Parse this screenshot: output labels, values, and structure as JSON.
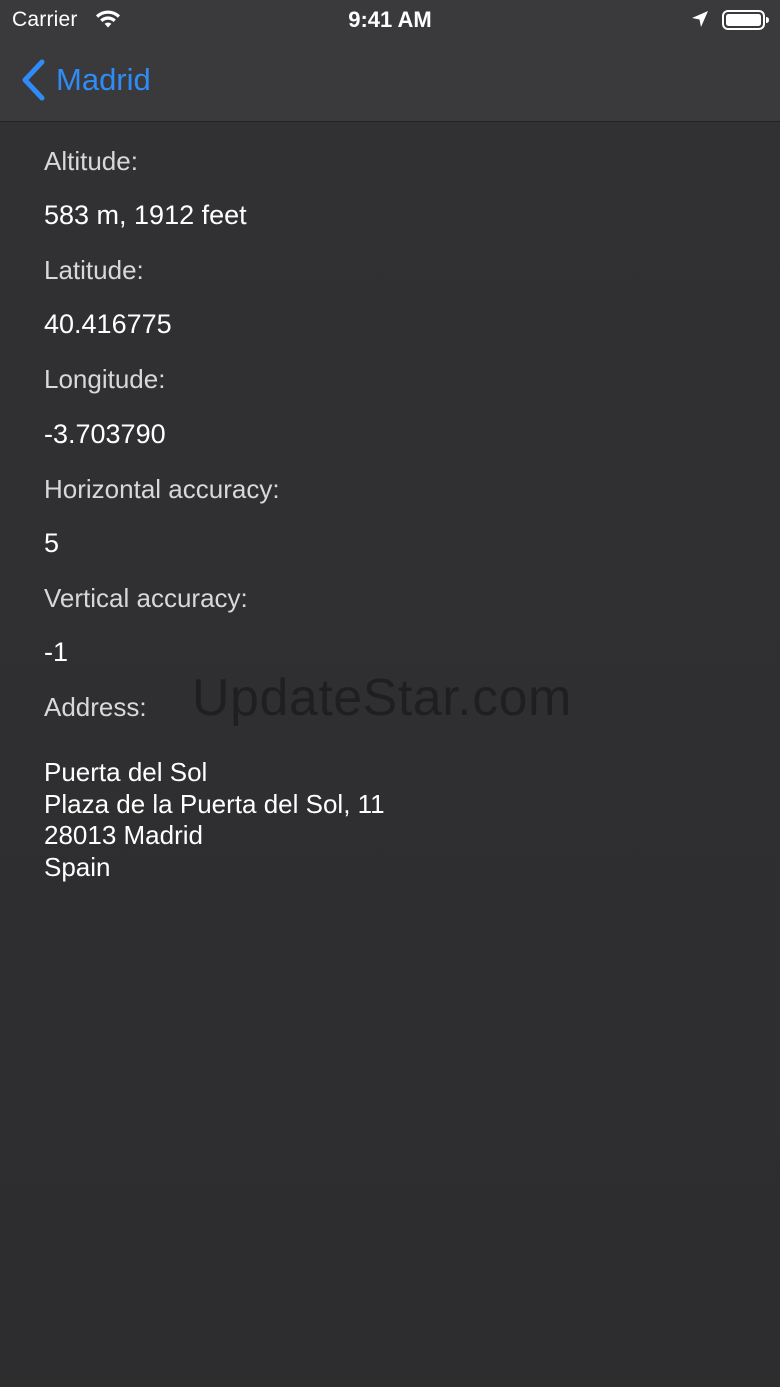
{
  "status_bar": {
    "carrier": "Carrier",
    "time": "9:41 AM",
    "icons": [
      "wifi-icon",
      "location-arrow-icon",
      "battery-icon"
    ]
  },
  "nav": {
    "back_label": "Madrid",
    "back_icon": "chevron-left-icon",
    "accent_color": "#2f8cf6"
  },
  "details": {
    "altitude": {
      "label": "Altitude:",
      "value": "583 m, 1912 feet"
    },
    "latitude": {
      "label": "Latitude:",
      "value": "40.416775"
    },
    "longitude": {
      "label": "Longitude:",
      "value": "-3.703790"
    },
    "horizontal_accuracy": {
      "label": "Horizontal accuracy:",
      "value": "5"
    },
    "vertical_accuracy": {
      "label": "Vertical accuracy:",
      "value": "-1"
    },
    "address": {
      "label": "Address:",
      "lines": [
        "Puerta del Sol",
        "Plaza de la Puerta del Sol, 11",
        "28013 Madrid",
        "Spain"
      ]
    }
  },
  "watermark": "UpdateStar.com"
}
